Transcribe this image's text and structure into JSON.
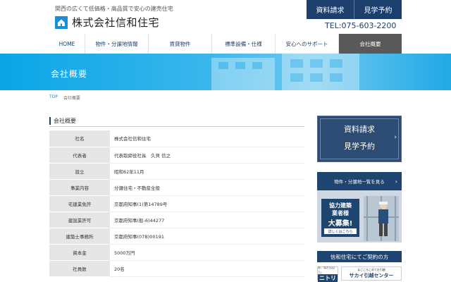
{
  "header": {
    "tagline": "関西の広くて低価格・高品質で安心の建売住宅",
    "logo_text": "株式会社信和住宅",
    "request_label": "資料請求",
    "visit_label": "見学予約",
    "tel": "TEL:075-603-2200"
  },
  "nav": {
    "items": [
      {
        "label": "HOME"
      },
      {
        "label": "物件・分譲地情報"
      },
      {
        "label": "賃貸物件"
      },
      {
        "label": "標準設備・仕様"
      },
      {
        "label": "安心へのサポート"
      },
      {
        "label": "会社概要"
      }
    ]
  },
  "hero": {
    "title": "会社概要"
  },
  "breadcrumb": {
    "home": "TOP",
    "current": "会社概要"
  },
  "section": {
    "title": "会社概要"
  },
  "company_table": {
    "rows": [
      {
        "label": "社名",
        "value": "株式会社信和住宅"
      },
      {
        "label": "代表者",
        "value": "代表取締役社長　久貝 信之"
      },
      {
        "label": "設立",
        "value": "昭和62年11月"
      },
      {
        "label": "事業内容",
        "value": "分譲住宅・不動産全般"
      },
      {
        "label": "宅建業免許",
        "value": "京都府知事(1)第14789号"
      },
      {
        "label": "建設業許可",
        "value": "京都府知事(般-6)44277"
      },
      {
        "label": "建築士事務所",
        "value": "京都府知事(07B)00191"
      },
      {
        "label": "資本金",
        "value": "5000万円"
      },
      {
        "label": "社員数",
        "value": "20名"
      }
    ]
  },
  "sidebar": {
    "request_line1": "資料請求",
    "request_line2": "見学予約",
    "list_label": "物件・分譲地一覧を見る",
    "recruit_line1": "協力建築",
    "recruit_line2": "業者様",
    "recruit_line3": "大募集!",
    "recruit_button": "詳しくはこちら",
    "contract_title": "信和住宅にてご契約の方",
    "nitori_sub": "お、ねだん以上。",
    "nitori_mark": "ニトリ",
    "sakai_sub": "まごころこめてお引越",
    "sakai_name": "サカイ引越センター"
  },
  "colors": {
    "navy": "#1c3f6e",
    "hero_blue": "#0aa5e6",
    "active_nav": "#595959"
  }
}
